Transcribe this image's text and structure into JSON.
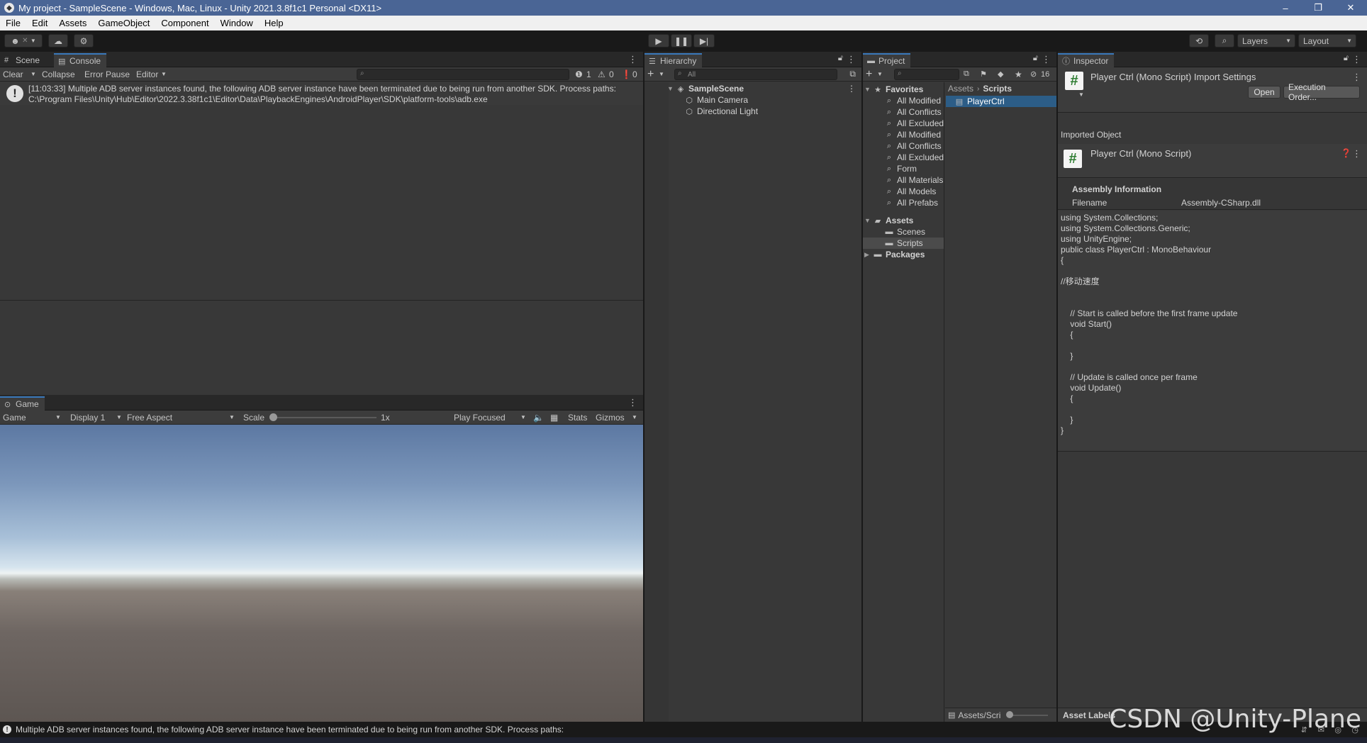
{
  "window": {
    "title": "My project - SampleScene - Windows, Mac, Linux - Unity 2021.3.8f1c1 Personal <DX11>",
    "minimize": "–",
    "restore": "❐",
    "close": "✕"
  },
  "menu": [
    "File",
    "Edit",
    "Assets",
    "GameObject",
    "Component",
    "Window",
    "Help"
  ],
  "toolbar": {
    "layers_label": "Layers",
    "layout_label": "Layout"
  },
  "scene_console": {
    "tabs": [
      "Scene",
      "Console"
    ],
    "buttons": [
      "Clear",
      "Collapse",
      "Error Pause",
      "Editor"
    ],
    "counts": {
      "info": "1",
      "warning": "0",
      "error": "0"
    },
    "log_line1": "[11:03:33] Multiple ADB server instances found, the following ADB server instance have been terminated due to being run from another SDK. Process paths:",
    "log_line2": "C:\\Program Files\\Unity\\Hub\\Editor\\2022.3.38f1c1\\Editor\\Data\\PlaybackEngines\\AndroidPlayer\\SDK\\platform-tools\\adb.exe"
  },
  "game": {
    "tab": "Game",
    "mode": "Game",
    "display": "Display 1",
    "aspect": "Free Aspect",
    "scale_label": "Scale",
    "scale_value": "1x",
    "play_focused": "Play Focused",
    "stats": "Stats",
    "gizmos": "Gizmos"
  },
  "hierarchy": {
    "tab": "Hierarchy",
    "search_placeholder": "All",
    "scene": "SampleScene",
    "items": [
      "Main Camera",
      "Directional Light"
    ]
  },
  "project": {
    "tab": "Project",
    "hidden_count": "16",
    "favorites_label": "Favorites",
    "favorites": [
      "All Modified",
      "All Conflicts",
      "All Excluded",
      "All Modified",
      "All Conflicts",
      "All Excluded",
      "Form",
      "All Materials",
      "All Models",
      "All Prefabs"
    ],
    "assets_label": "Assets",
    "assets_children": [
      "Scenes",
      "Scripts"
    ],
    "packages_label": "Packages",
    "breadcrumb": [
      "Assets",
      "Scripts"
    ],
    "files": [
      "PlayerCtrl"
    ],
    "footer_path": "Assets/Scri"
  },
  "inspector": {
    "tab": "Inspector",
    "header_title": "Player Ctrl (Mono Script) Import Settings",
    "open_button": "Open",
    "execution_order_button": "Execution Order...",
    "imported_object_label": "Imported Object",
    "object_title": "Player Ctrl (Mono Script)",
    "assembly_heading": "Assembly Information",
    "filename_label": "Filename",
    "filename_value": "Assembly-CSharp.dll",
    "code": [
      "using System.Collections;",
      "using System.Collections.Generic;",
      "using UnityEngine;",
      "public class PlayerCtrl : MonoBehaviour",
      "{",
      "",
      "//移动速度",
      "",
      "",
      "    // Start is called before the first frame update",
      "    void Start()",
      "    {",
      "",
      "    }",
      "",
      "    // Update is called once per frame",
      "    void Update()",
      "    {",
      "",
      "    }",
      "}"
    ],
    "asset_labels": "Asset Labels"
  },
  "status": {
    "message": "Multiple ADB server instances found, the following ADB server instance have been terminated due to being run from another SDK. Process paths:"
  },
  "watermark": "CSDN @Unity-Plane",
  "colors": {
    "accent": "#3a79bb",
    "selection": "#2c5d87",
    "title_bar": "#4a6595"
  }
}
